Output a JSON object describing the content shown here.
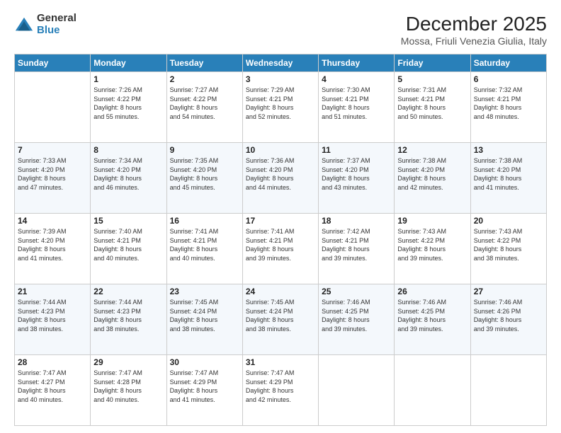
{
  "logo": {
    "general": "General",
    "blue": "Blue"
  },
  "header": {
    "title": "December 2025",
    "location": "Mossa, Friuli Venezia Giulia, Italy"
  },
  "weekdays": [
    "Sunday",
    "Monday",
    "Tuesday",
    "Wednesday",
    "Thursday",
    "Friday",
    "Saturday"
  ],
  "weeks": [
    [
      {
        "day": "",
        "info": ""
      },
      {
        "day": "1",
        "info": "Sunrise: 7:26 AM\nSunset: 4:22 PM\nDaylight: 8 hours\nand 55 minutes."
      },
      {
        "day": "2",
        "info": "Sunrise: 7:27 AM\nSunset: 4:22 PM\nDaylight: 8 hours\nand 54 minutes."
      },
      {
        "day": "3",
        "info": "Sunrise: 7:29 AM\nSunset: 4:21 PM\nDaylight: 8 hours\nand 52 minutes."
      },
      {
        "day": "4",
        "info": "Sunrise: 7:30 AM\nSunset: 4:21 PM\nDaylight: 8 hours\nand 51 minutes."
      },
      {
        "day": "5",
        "info": "Sunrise: 7:31 AM\nSunset: 4:21 PM\nDaylight: 8 hours\nand 50 minutes."
      },
      {
        "day": "6",
        "info": "Sunrise: 7:32 AM\nSunset: 4:21 PM\nDaylight: 8 hours\nand 48 minutes."
      }
    ],
    [
      {
        "day": "7",
        "info": "Sunrise: 7:33 AM\nSunset: 4:20 PM\nDaylight: 8 hours\nand 47 minutes."
      },
      {
        "day": "8",
        "info": "Sunrise: 7:34 AM\nSunset: 4:20 PM\nDaylight: 8 hours\nand 46 minutes."
      },
      {
        "day": "9",
        "info": "Sunrise: 7:35 AM\nSunset: 4:20 PM\nDaylight: 8 hours\nand 45 minutes."
      },
      {
        "day": "10",
        "info": "Sunrise: 7:36 AM\nSunset: 4:20 PM\nDaylight: 8 hours\nand 44 minutes."
      },
      {
        "day": "11",
        "info": "Sunrise: 7:37 AM\nSunset: 4:20 PM\nDaylight: 8 hours\nand 43 minutes."
      },
      {
        "day": "12",
        "info": "Sunrise: 7:38 AM\nSunset: 4:20 PM\nDaylight: 8 hours\nand 42 minutes."
      },
      {
        "day": "13",
        "info": "Sunrise: 7:38 AM\nSunset: 4:20 PM\nDaylight: 8 hours\nand 41 minutes."
      }
    ],
    [
      {
        "day": "14",
        "info": "Sunrise: 7:39 AM\nSunset: 4:20 PM\nDaylight: 8 hours\nand 41 minutes."
      },
      {
        "day": "15",
        "info": "Sunrise: 7:40 AM\nSunset: 4:21 PM\nDaylight: 8 hours\nand 40 minutes."
      },
      {
        "day": "16",
        "info": "Sunrise: 7:41 AM\nSunset: 4:21 PM\nDaylight: 8 hours\nand 40 minutes."
      },
      {
        "day": "17",
        "info": "Sunrise: 7:41 AM\nSunset: 4:21 PM\nDaylight: 8 hours\nand 39 minutes."
      },
      {
        "day": "18",
        "info": "Sunrise: 7:42 AM\nSunset: 4:21 PM\nDaylight: 8 hours\nand 39 minutes."
      },
      {
        "day": "19",
        "info": "Sunrise: 7:43 AM\nSunset: 4:22 PM\nDaylight: 8 hours\nand 39 minutes."
      },
      {
        "day": "20",
        "info": "Sunrise: 7:43 AM\nSunset: 4:22 PM\nDaylight: 8 hours\nand 38 minutes."
      }
    ],
    [
      {
        "day": "21",
        "info": "Sunrise: 7:44 AM\nSunset: 4:23 PM\nDaylight: 8 hours\nand 38 minutes."
      },
      {
        "day": "22",
        "info": "Sunrise: 7:44 AM\nSunset: 4:23 PM\nDaylight: 8 hours\nand 38 minutes."
      },
      {
        "day": "23",
        "info": "Sunrise: 7:45 AM\nSunset: 4:24 PM\nDaylight: 8 hours\nand 38 minutes."
      },
      {
        "day": "24",
        "info": "Sunrise: 7:45 AM\nSunset: 4:24 PM\nDaylight: 8 hours\nand 38 minutes."
      },
      {
        "day": "25",
        "info": "Sunrise: 7:46 AM\nSunset: 4:25 PM\nDaylight: 8 hours\nand 39 minutes."
      },
      {
        "day": "26",
        "info": "Sunrise: 7:46 AM\nSunset: 4:25 PM\nDaylight: 8 hours\nand 39 minutes."
      },
      {
        "day": "27",
        "info": "Sunrise: 7:46 AM\nSunset: 4:26 PM\nDaylight: 8 hours\nand 39 minutes."
      }
    ],
    [
      {
        "day": "28",
        "info": "Sunrise: 7:47 AM\nSunset: 4:27 PM\nDaylight: 8 hours\nand 40 minutes."
      },
      {
        "day": "29",
        "info": "Sunrise: 7:47 AM\nSunset: 4:28 PM\nDaylight: 8 hours\nand 40 minutes."
      },
      {
        "day": "30",
        "info": "Sunrise: 7:47 AM\nSunset: 4:29 PM\nDaylight: 8 hours\nand 41 minutes."
      },
      {
        "day": "31",
        "info": "Sunrise: 7:47 AM\nSunset: 4:29 PM\nDaylight: 8 hours\nand 42 minutes."
      },
      {
        "day": "",
        "info": ""
      },
      {
        "day": "",
        "info": ""
      },
      {
        "day": "",
        "info": ""
      }
    ]
  ]
}
